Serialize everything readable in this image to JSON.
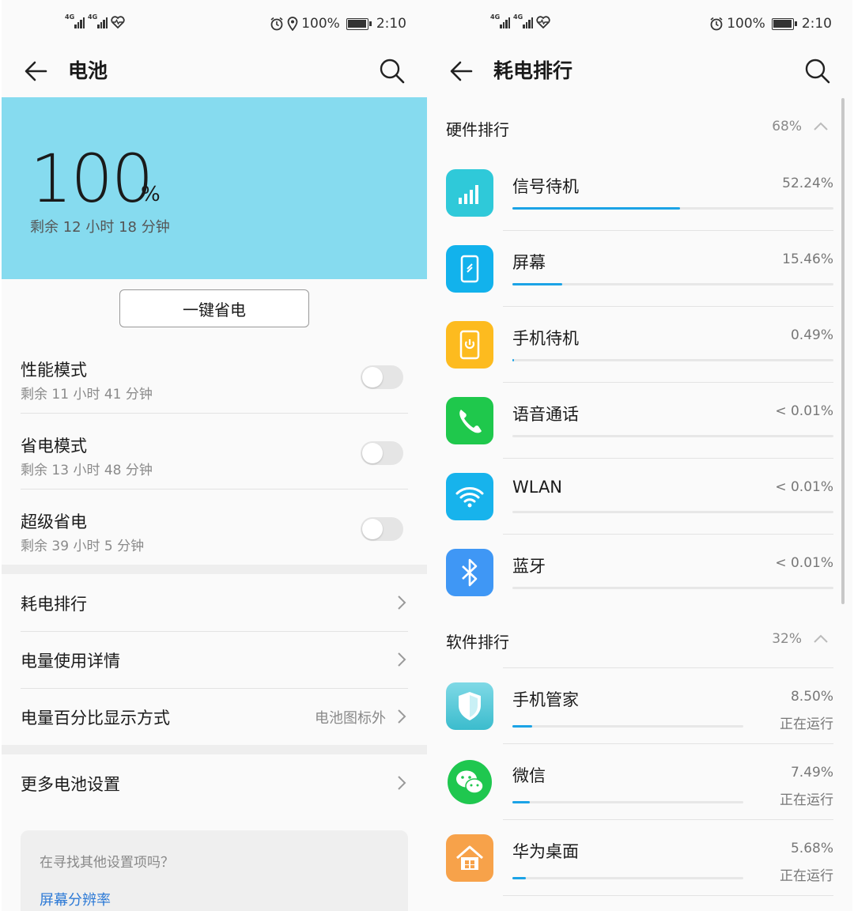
{
  "left": {
    "status_bar": {
      "signal1_label": "4G",
      "signal2_label": "4G",
      "icons": [
        "alarm-icon",
        "location-icon",
        "battery-icon",
        "heart-icon"
      ],
      "battery_pct": "100%",
      "time": "2:10"
    },
    "title": "电池",
    "battery": {
      "percent": "100",
      "percent_sign": "%",
      "remaining": "剩余 12 小时 18 分钟"
    },
    "save_button": "一键省电",
    "modes": [
      {
        "title": "性能模式",
        "subtitle": "剩余 11 小时 41 分钟",
        "enabled": false
      },
      {
        "title": "省电模式",
        "subtitle": "剩余 13 小时 48 分钟",
        "enabled": false
      },
      {
        "title": "超级省电",
        "subtitle": "剩余 39 小时 5 分钟",
        "enabled": false
      }
    ],
    "nav": [
      {
        "label": "耗电排行",
        "value": ""
      },
      {
        "label": "电量使用详情",
        "value": ""
      },
      {
        "label": "电量百分比显示方式",
        "value": "电池图标外"
      },
      {
        "label": "更多电池设置",
        "value": ""
      }
    ],
    "suggest": {
      "question": "在寻找其他设置项吗？",
      "link": "屏幕分辨率"
    }
  },
  "right": {
    "status_bar": {
      "signal1_label": "4G",
      "signal2_label": "4G",
      "battery_pct": "100%",
      "time": "2:10"
    },
    "title": "耗电排行",
    "hardware": {
      "title": "硬件排行",
      "percent": "68%",
      "items": [
        {
          "name": "信号待机",
          "percent": "52.24%",
          "fraction": 0.5224,
          "icon": "signal-icon",
          "color": "#2fc9d9"
        },
        {
          "name": "屏幕",
          "percent": "15.46%",
          "fraction": 0.1546,
          "icon": "screen-icon",
          "color": "#12b2ec"
        },
        {
          "name": "手机待机",
          "percent": "0.49%",
          "fraction": 0.0049,
          "icon": "phone-standby-icon",
          "color": "#fdbb1f"
        },
        {
          "name": "语音通话",
          "percent": "< 0.01%",
          "fraction": 0.0,
          "icon": "call-icon",
          "color": "#1fc84c"
        },
        {
          "name": "WLAN",
          "percent": "< 0.01%",
          "fraction": 0.0,
          "icon": "wifi-icon",
          "color": "#17b3ec"
        },
        {
          "name": "蓝牙",
          "percent": "< 0.01%",
          "fraction": 0.0,
          "icon": "bluetooth-icon",
          "color": "#3f97f5"
        }
      ]
    },
    "software": {
      "title": "软件排行",
      "percent": "32%",
      "items": [
        {
          "name": "手机管家",
          "percent": "8.50%",
          "status": "正在运行",
          "fraction": 0.085,
          "icon": "phone-manager-icon"
        },
        {
          "name": "微信",
          "percent": "7.49%",
          "status": "正在运行",
          "fraction": 0.0749,
          "icon": "wechat-icon"
        },
        {
          "name": "华为桌面",
          "percent": "5.68%",
          "status": "正在运行",
          "fraction": 0.0568,
          "icon": "huawei-home-icon"
        }
      ]
    }
  }
}
